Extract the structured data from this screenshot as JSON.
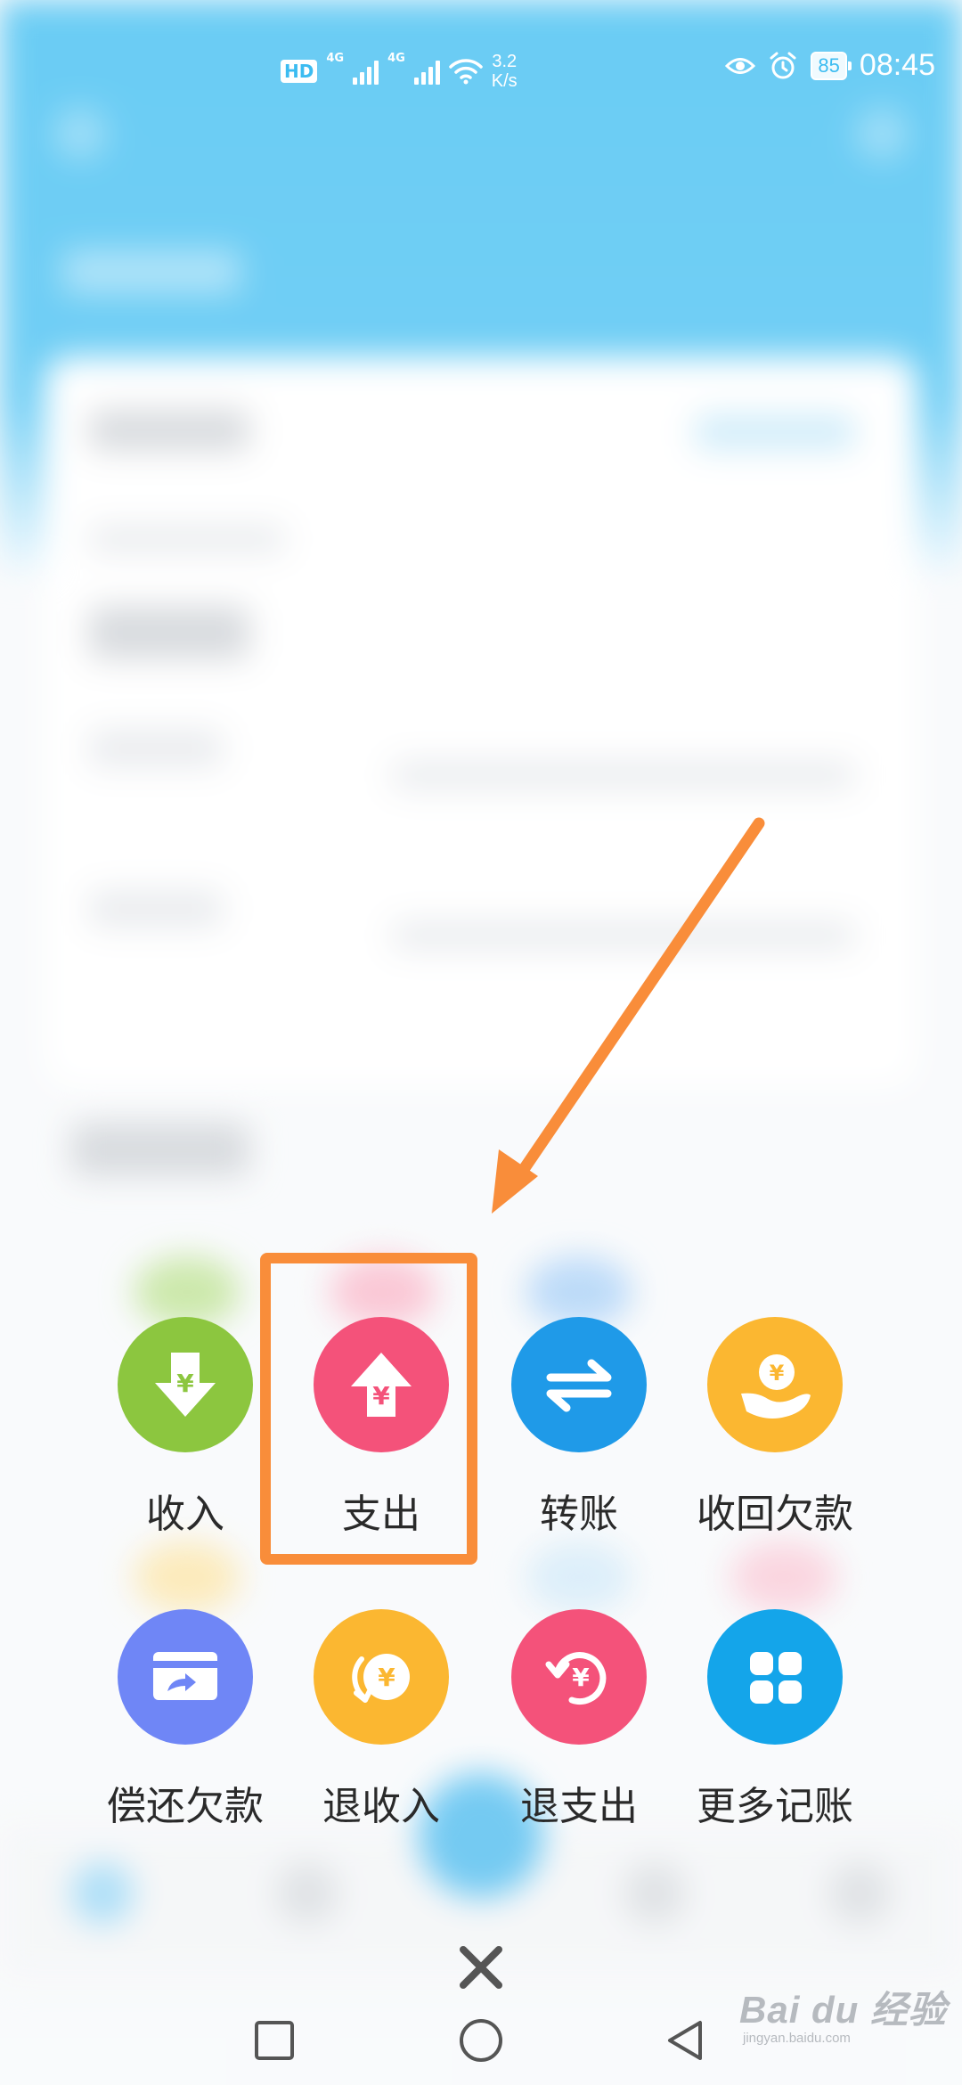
{
  "status_bar": {
    "hd_label": "HD",
    "network_1": "4G",
    "network_2": "4G",
    "speed_value": "3.2",
    "speed_unit": "K/s",
    "battery": "85",
    "time": "08:45"
  },
  "actions": [
    {
      "label": "收入",
      "icon": "download-yuan-icon",
      "color": "#8cc63f"
    },
    {
      "label": "支出",
      "icon": "upload-yuan-icon",
      "color": "#f4527a"
    },
    {
      "label": "转账",
      "icon": "transfer-arrows-icon",
      "color": "#1f9ae8"
    },
    {
      "label": "收回欠款",
      "icon": "hand-coin-icon",
      "color": "#fbb731"
    },
    {
      "label": "偿还欠款",
      "icon": "card-repay-icon",
      "color": "#6f86f6"
    },
    {
      "label": "退收入",
      "icon": "refund-income-icon",
      "color": "#fbb731"
    },
    {
      "label": "退支出",
      "icon": "refund-expense-icon",
      "color": "#f4527a"
    },
    {
      "label": "更多记账",
      "icon": "grid-more-icon",
      "color": "#14a5ea"
    }
  ],
  "annotation": {
    "highlight_color": "#f98d3a",
    "highlighted_item": "支出"
  },
  "close_icon": "close-icon",
  "navigation": {
    "buttons": [
      "recent-apps-icon",
      "home-icon",
      "back-icon"
    ]
  },
  "watermark": {
    "main": "Bai du 经验",
    "sub": "jingyan.baidu.com"
  }
}
